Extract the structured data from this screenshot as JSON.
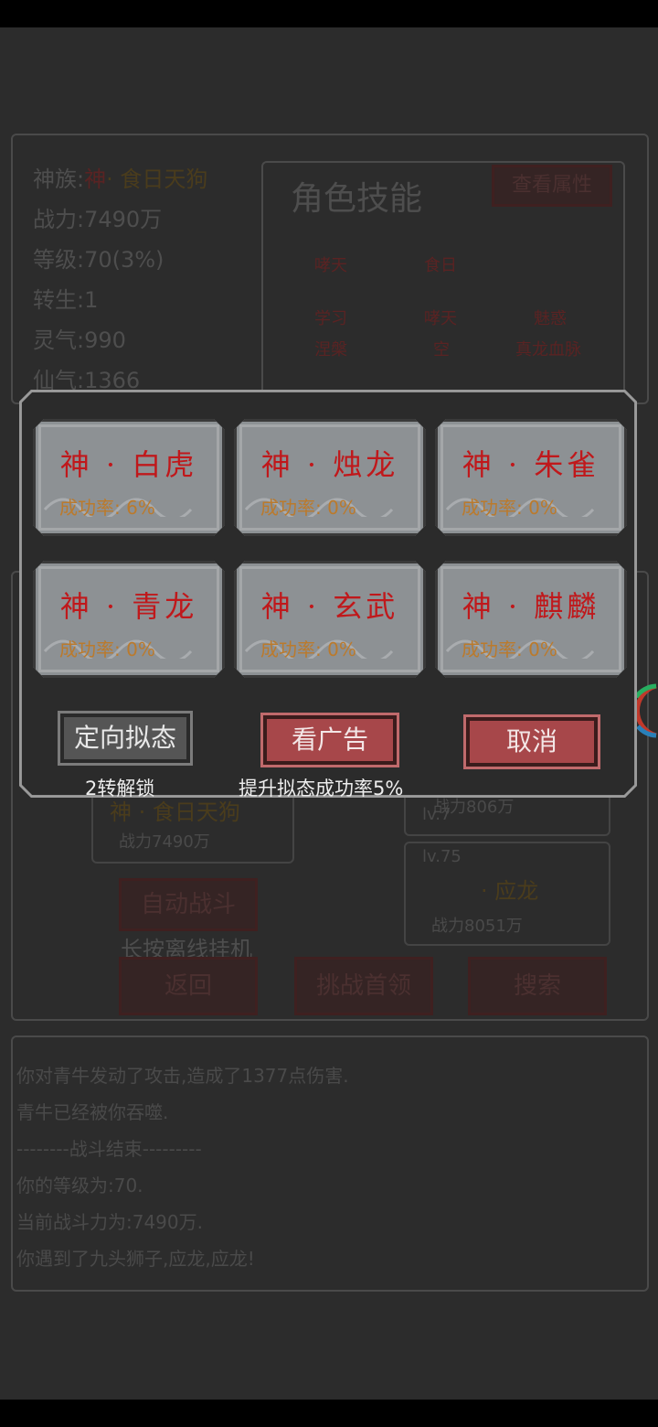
{
  "background": {
    "profile": {
      "race_label": "神族:",
      "race_prefix": "神",
      "race_name": "· 食日天狗",
      "power": "战力:7490万",
      "level": "等级:70(3%)",
      "rebirth": "转生:1",
      "spirit": "灵气:990",
      "immortal": "仙气:1366"
    },
    "skills": {
      "title": "角色技能",
      "view_attr_button": "查看属性",
      "row1": [
        "哮天",
        "食日"
      ],
      "row2": [
        "学习",
        "哮天",
        "魅惑"
      ],
      "row3": [
        "涅槃",
        "空",
        "真龙血脉"
      ]
    },
    "player_card": {
      "name": "神 · 食日天狗",
      "power": "战力7490万"
    },
    "enemy_card_1": {
      "level": "lv.7",
      "power": "战力806万"
    },
    "enemy_card_2": {
      "level": "lv.75",
      "name": "· 应龙",
      "power": "战力8051万"
    },
    "auto_battle_button": "自动战斗",
    "auto_battle_hint": "长按离线挂机",
    "back_button": "返回",
    "challenge_button": "挑战首领",
    "search_button": "搜索",
    "log": [
      "你对青牛发动了攻击,造成了1377点伤害.",
      "青牛已经被你吞噬.",
      "--------战斗结束---------",
      "你的等级为:70.",
      "当前战斗力为:7490万.",
      "你遇到了九头狮子,应龙,应龙!"
    ]
  },
  "modal": {
    "options": [
      {
        "name": "神 · 白虎",
        "rate": "成功率: 6%"
      },
      {
        "name": "神 · 烛龙",
        "rate": "成功率: 0%"
      },
      {
        "name": "神 · 朱雀",
        "rate": "成功率: 0%"
      },
      {
        "name": "神 · 青龙",
        "rate": "成功率: 0%"
      },
      {
        "name": "神 · 玄武",
        "rate": "成功率: 0%"
      },
      {
        "name": "神 · 麒麟",
        "rate": "成功率: 0%"
      }
    ],
    "directed_button": "定向拟态",
    "directed_caption": "2转解锁",
    "ad_button": "看广告",
    "ad_caption": "提升拟态成功率5%",
    "cancel_button": "取消"
  },
  "colors": {
    "card_name": "#c0181b",
    "card_rate": "#bb7a2c",
    "red_button": "#a7474a",
    "gray_button": "#555555"
  }
}
